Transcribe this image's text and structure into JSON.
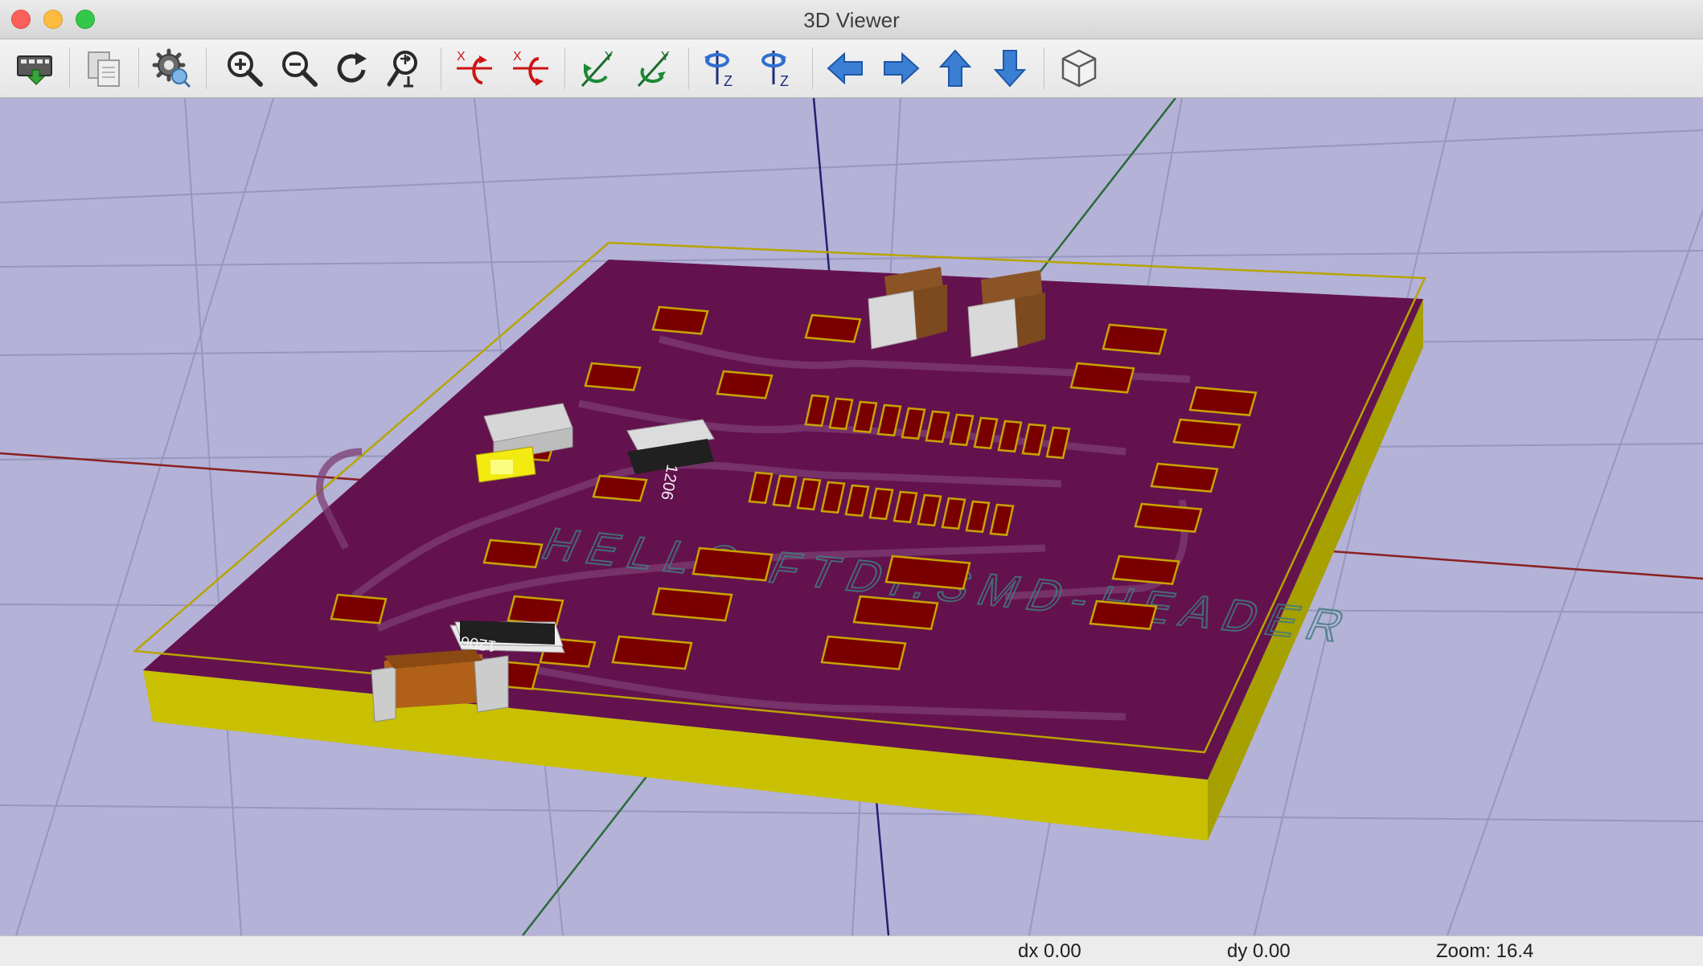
{
  "window": {
    "title": "3D Viewer"
  },
  "toolbar": {
    "buttons": [
      {
        "id": "export",
        "icon": "export-image-icon"
      },
      {
        "id": "copy",
        "icon": "copy-icon"
      },
      {
        "id": "settings",
        "icon": "settings-gear-icon"
      },
      {
        "id": "zoom_in",
        "icon": "zoom-in-icon"
      },
      {
        "id": "zoom_out",
        "icon": "zoom-out-icon"
      },
      {
        "id": "redraw",
        "icon": "redraw-icon"
      },
      {
        "id": "zoom_fit",
        "icon": "zoom-fit-icon"
      },
      {
        "id": "rotate_x_ccw",
        "icon": "rotate-x-ccw-icon",
        "label": "X"
      },
      {
        "id": "rotate_x_cw",
        "icon": "rotate-x-cw-icon",
        "label": "X"
      },
      {
        "id": "rotate_y_ccw",
        "icon": "rotate-y-ccw-icon",
        "label": "Y"
      },
      {
        "id": "rotate_y_cw",
        "icon": "rotate-y-cw-icon",
        "label": "Y"
      },
      {
        "id": "rotate_z_ccw",
        "icon": "rotate-z-ccw-icon",
        "label": "Z"
      },
      {
        "id": "rotate_z_cw",
        "icon": "rotate-z-cw-icon",
        "label": "Z"
      },
      {
        "id": "move_left",
        "icon": "arrow-left-icon"
      },
      {
        "id": "move_right",
        "icon": "arrow-right-icon"
      },
      {
        "id": "move_up",
        "icon": "arrow-up-icon"
      },
      {
        "id": "move_down",
        "icon": "arrow-down-icon"
      },
      {
        "id": "ortho",
        "icon": "cube-view-icon"
      }
    ]
  },
  "viewport": {
    "silkscreen_text": "HELLO.FTDI.SMD-HEADER",
    "component_labels": [
      "1206",
      "1206"
    ],
    "colors": {
      "background": "#b4b2d7",
      "grid": "#9897bb",
      "board_top": "#5c0a44",
      "board_edge": "#c8c000",
      "pad": "#7a0000",
      "pad_outline": "#c9a400",
      "axis_x": "#8a2020",
      "axis_y": "#2a6a3a",
      "axis_z": "#22206e"
    }
  },
  "status": {
    "dx": "dx 0.00",
    "dy": "dy 0.00",
    "zoom": "Zoom: 16.4"
  }
}
